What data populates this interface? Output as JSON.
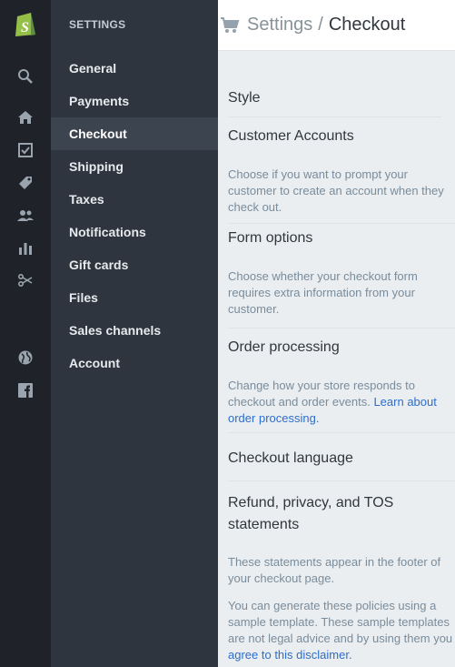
{
  "rail": {
    "icons": [
      "shopify-logo",
      "search-icon",
      "home-icon",
      "orders-icon",
      "products-icon",
      "customers-icon",
      "reports-icon",
      "discounts-icon",
      "online-store-icon",
      "facebook-icon"
    ]
  },
  "sidebar": {
    "heading": "SETTINGS",
    "items": [
      {
        "label": "General"
      },
      {
        "label": "Payments"
      },
      {
        "label": "Checkout",
        "active": true
      },
      {
        "label": "Shipping"
      },
      {
        "label": "Taxes"
      },
      {
        "label": "Notifications"
      },
      {
        "label": "Gift cards"
      },
      {
        "label": "Files"
      },
      {
        "label": "Sales channels"
      },
      {
        "label": "Account"
      }
    ]
  },
  "header": {
    "breadcrumb_parent": "Settings",
    "separator": "/",
    "breadcrumb_current": "Checkout"
  },
  "sections": {
    "style": {
      "title": "Style"
    },
    "customer_accounts": {
      "title": "Customer Accounts",
      "description": "Choose if you want to prompt your customer to create an account when they check out."
    },
    "form_options": {
      "title": "Form options",
      "description": "Choose whether your checkout form requires extra information from your customer."
    },
    "order_processing": {
      "title": "Order processing",
      "description": "Change how your store responds to checkout and order events.",
      "link": "Learn about order processing."
    },
    "checkout_language": {
      "title": "Checkout language"
    },
    "refund_privacy_tos": {
      "title": "Refund, privacy, and TOS statements",
      "description": "These statements appear in the footer of your checkout page.",
      "description2": "You can generate these policies using a sample template. These sample templates are not legal advice and by using them you",
      "link": "agree to this disclaimer."
    }
  },
  "colors": {
    "rail_bg": "#1f2329",
    "sidebar_bg": "#2f353e",
    "sidebar_active_bg": "#3c444f",
    "link": "#2c6ecb",
    "brand_green": "#95bf47"
  }
}
